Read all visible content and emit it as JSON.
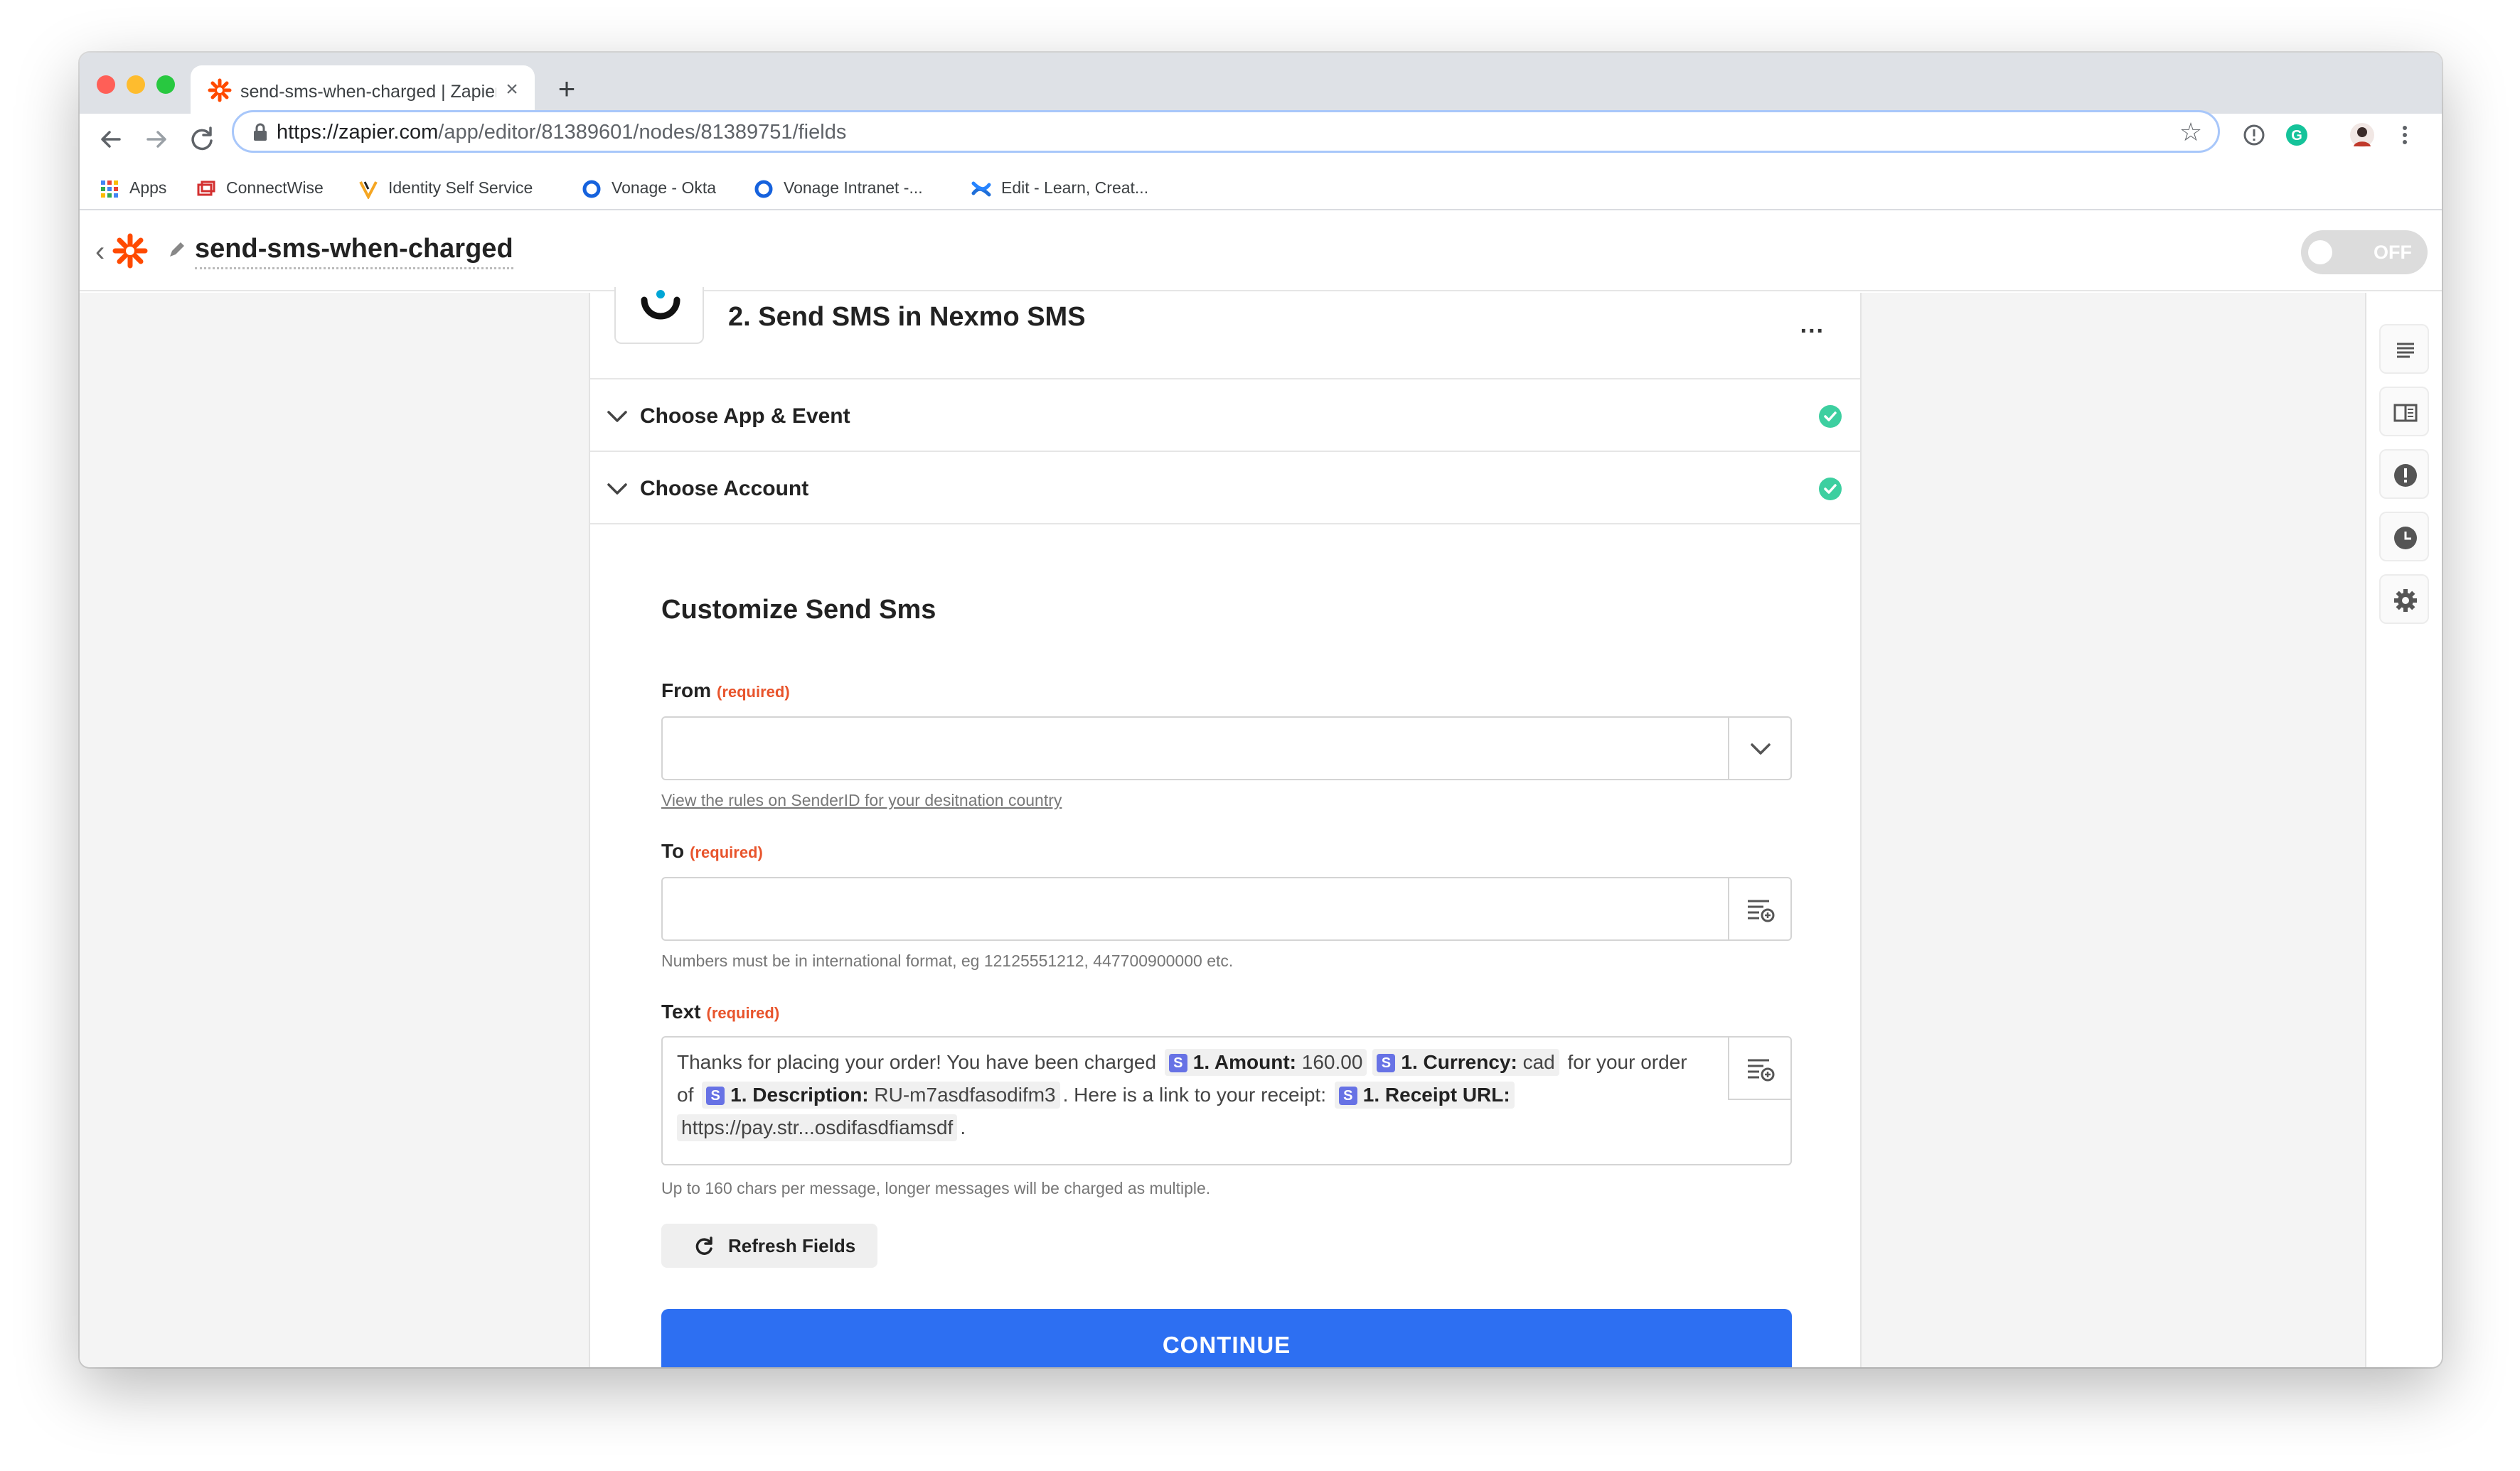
{
  "browser": {
    "tab_title": "send-sms-when-charged | Zapier",
    "tab_close": "×",
    "new_tab": "+",
    "url_host": "https://zapier.com",
    "url_path": "/app/editor/81389601/nodes/81389751/fields",
    "bookmarks": [
      {
        "label": "Apps",
        "icon": "apps-grid-icon"
      },
      {
        "label": "ConnectWise",
        "icon": "connectwise-icon"
      },
      {
        "label": "Identity Self Service",
        "icon": "vonage-v-icon"
      },
      {
        "label": "Vonage - Okta",
        "icon": "okta-icon"
      },
      {
        "label": "Vonage Intranet -...",
        "icon": "okta-icon"
      },
      {
        "label": "Edit - Learn, Creat...",
        "icon": "confluence-icon"
      }
    ],
    "traffic_light_colors": [
      "#ff5f57",
      "#febc2e",
      "#28c840"
    ]
  },
  "zap": {
    "name": "send-sms-when-charged",
    "toggle_label": "OFF",
    "brand_color": "#ff4a00"
  },
  "step": {
    "title": "2. Send SMS in Nexmo SMS",
    "more_label": "...",
    "sections": [
      {
        "label": "Choose App & Event",
        "status": "complete"
      },
      {
        "label": "Choose Account",
        "status": "complete"
      }
    ]
  },
  "form": {
    "title": "Customize Send Sms",
    "required_tag": "(required)",
    "from": {
      "label": "From",
      "value": "",
      "help_link": "View the rules on SenderID for your desitnation country"
    },
    "to": {
      "label": "To",
      "value": "",
      "help": "Numbers must be in international format, eg 12125551212, 447700900000 etc."
    },
    "text": {
      "label": "Text",
      "segments": {
        "t1": "Thanks for placing your order! You have been charged",
        "p1_label": "1. Amount:",
        "p1_value": "160.00",
        "p2_label": "1. Currency:",
        "p2_value": "cad",
        "t2": "for your order of",
        "p3_label": "1. Description:",
        "p3_value": "RU-m7asdfasodifm3",
        "t3": ". Here is a link to your receipt:",
        "p4_label": "1. Receipt URL:",
        "p4_value": "https://pay.str...osdifasdfiamsdf",
        "t4": "."
      },
      "pill_badge": "S",
      "help": "Up to 160 chars per message, longer messages will be charged as multiple."
    },
    "refresh_label": "Refresh Fields",
    "continue_label": "CONTINUE",
    "accent_color": "#2d6ff2",
    "check_color": "#3dcfa0"
  }
}
